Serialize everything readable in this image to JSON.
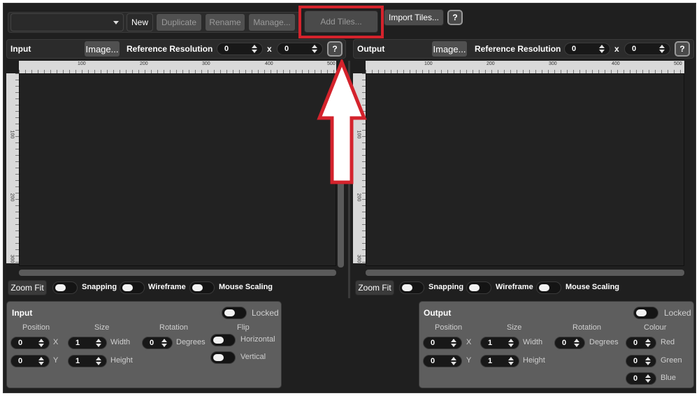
{
  "toolbar": {
    "dropdown_value": "",
    "new_label": "New",
    "duplicate_label": "Duplicate",
    "rename_label": "Rename",
    "manage_label": "Manage...",
    "add_tiles_label": "Add Tiles...",
    "import_tiles_label": "Import Tiles...",
    "help_label": "?"
  },
  "input_view": {
    "title": "Input",
    "image_label": "Image...",
    "ref_res_label": "Reference Resolution",
    "ref_res_x": "0",
    "ref_res_x_sep": "x",
    "ref_res_y": "0",
    "help_label": "?",
    "ruler_h_ticks": [
      "100",
      "200",
      "300",
      "400",
      "500"
    ],
    "ruler_v_ticks": [
      "100",
      "200",
      "300"
    ],
    "zoom_fit_label": "Zoom Fit",
    "snapping_label": "Snapping",
    "wireframe_label": "Wireframe",
    "mouse_scaling_label": "Mouse Scaling"
  },
  "output_view": {
    "title": "Output",
    "image_label": "Image...",
    "ref_res_label": "Reference Resolution",
    "ref_res_x": "0",
    "ref_res_x_sep": "x",
    "ref_res_y": "0",
    "help_label": "?",
    "ruler_h_ticks": [
      "100",
      "200",
      "300",
      "400",
      "500"
    ],
    "ruler_v_ticks": [
      "100",
      "200",
      "300"
    ],
    "zoom_fit_label": "Zoom Fit",
    "snapping_label": "Snapping",
    "wireframe_label": "Wireframe",
    "mouse_scaling_label": "Mouse Scaling"
  },
  "input_panel": {
    "title": "Input",
    "locked_label": "Locked",
    "position_label": "Position",
    "size_label": "Size",
    "rotation_label": "Rotation",
    "flip_label": "Flip",
    "pos_x": "0",
    "x_label": "X",
    "pos_y": "0",
    "y_label": "Y",
    "width": "1",
    "width_label": "Width",
    "height": "1",
    "height_label": "Height",
    "rotation": "0",
    "degrees_label": "Degrees",
    "horizontal_label": "Horizontal",
    "vertical_label": "Vertical"
  },
  "output_panel": {
    "title": "Output",
    "locked_label": "Locked",
    "position_label": "Position",
    "size_label": "Size",
    "rotation_label": "Rotation",
    "colour_label": "Colour",
    "pos_x": "0",
    "x_label": "X",
    "pos_y": "0",
    "y_label": "Y",
    "width": "1",
    "width_label": "Width",
    "height": "1",
    "height_label": "Height",
    "rotation": "0",
    "degrees_label": "Degrees",
    "red": "0",
    "red_label": "Red",
    "green": "0",
    "green_label": "Green",
    "blue": "0",
    "blue_label": "Blue"
  },
  "colors": {
    "highlight": "#d4232c",
    "background": "#1f1f1f",
    "panel": "#5e5e5e"
  }
}
